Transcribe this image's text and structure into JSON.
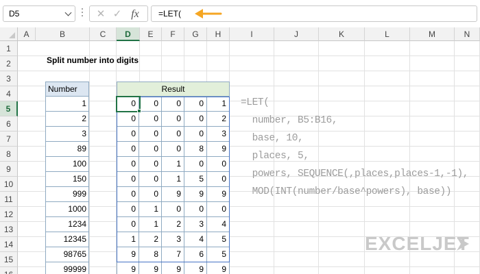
{
  "name_box": {
    "value": "D5"
  },
  "formula_bar": {
    "cancel_icon": "✕",
    "enter_icon": "✓",
    "fx_label": "fx",
    "formula": "=LET("
  },
  "columns": [
    "A",
    "B",
    "C",
    "D",
    "E",
    "F",
    "G",
    "H",
    "I",
    "J",
    "K",
    "L",
    "M",
    "N"
  ],
  "rows": [
    "1",
    "2",
    "3",
    "4",
    "5",
    "6",
    "7",
    "8",
    "9",
    "10",
    "11",
    "12",
    "13",
    "14",
    "15",
    "16"
  ],
  "selected": {
    "column": "D",
    "row": "5"
  },
  "sheet": {
    "title": "Split number into digits",
    "number_header": "Number",
    "numbers": [
      "1",
      "2",
      "3",
      "89",
      "100",
      "150",
      "999",
      "1000",
      "1234",
      "12345",
      "98765",
      "99999"
    ],
    "result_header": "Result",
    "results": [
      [
        "0",
        "0",
        "0",
        "0",
        "1"
      ],
      [
        "0",
        "0",
        "0",
        "0",
        "2"
      ],
      [
        "0",
        "0",
        "0",
        "0",
        "3"
      ],
      [
        "0",
        "0",
        "0",
        "8",
        "9"
      ],
      [
        "0",
        "0",
        "1",
        "0",
        "0"
      ],
      [
        "0",
        "0",
        "1",
        "5",
        "0"
      ],
      [
        "0",
        "0",
        "9",
        "9",
        "9"
      ],
      [
        "0",
        "1",
        "0",
        "0",
        "0"
      ],
      [
        "0",
        "1",
        "2",
        "3",
        "4"
      ],
      [
        "1",
        "2",
        "3",
        "4",
        "5"
      ],
      [
        "9",
        "8",
        "7",
        "6",
        "5"
      ],
      [
        "9",
        "9",
        "9",
        "9",
        "9"
      ]
    ]
  },
  "formula_display": [
    "=LET(",
    "  number, B5:B16,",
    "  base, 10,",
    "  places, 5,",
    "  powers, SEQUENCE(,places,places-1,-1),",
    "  MOD(INT(number/base^powers), base))"
  ],
  "logo": {
    "text": "EXCELJET"
  },
  "colors": {
    "accent": "#217346",
    "arrow": "#f5a623",
    "number_header_bg": "#dce6f1",
    "result_header_bg": "#e2efda"
  }
}
